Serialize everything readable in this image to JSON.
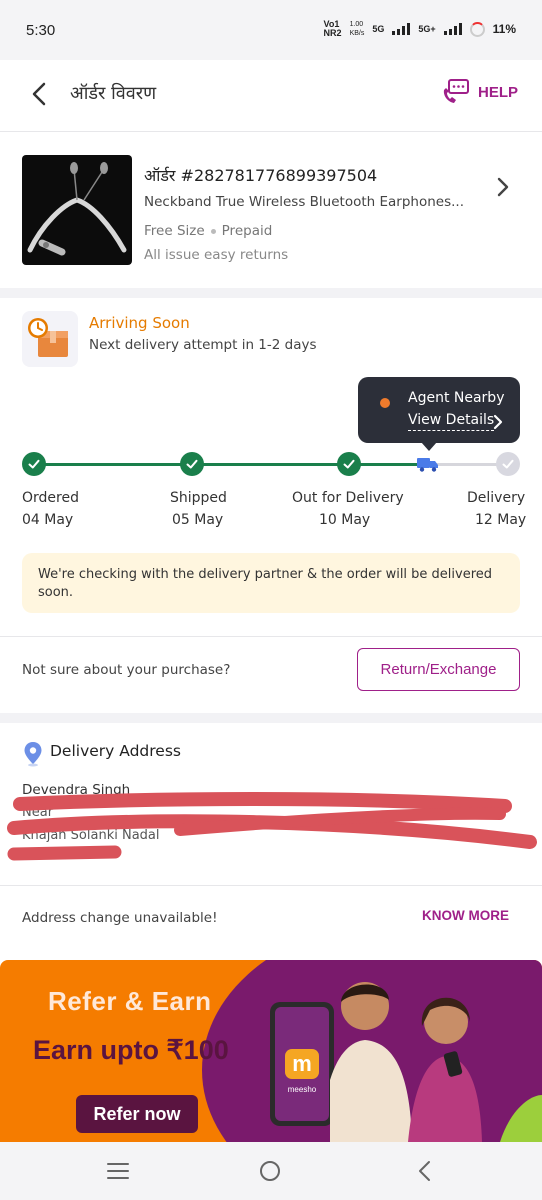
{
  "status_bar": {
    "time": "5:30",
    "carrier_top": "Vo1",
    "carrier_bottom": "NR2",
    "speed_top": "1.00",
    "speed_bottom": "KB/s",
    "net1": "5G",
    "net2": "5G+",
    "battery": "11%"
  },
  "header": {
    "title": "ऑर्डर विवरण",
    "help_label": "HELP"
  },
  "product": {
    "order_id": "ऑर्डर #282781776899397504",
    "name": "Neckband True Wireless Bluetooth Earphones...",
    "size": "Free Size",
    "payment": "Prepaid",
    "returns": "All issue easy returns"
  },
  "delivery": {
    "status": "Arriving Soon",
    "subtext": "Next delivery attempt in 1-2 days",
    "tooltip_title": "Agent Nearby",
    "tooltip_link": "View Details",
    "steps": [
      {
        "label": "Ordered",
        "date": "04 May"
      },
      {
        "label": "Shipped",
        "date": "05 May"
      },
      {
        "label": "Out for Delivery",
        "date": "10 May"
      },
      {
        "label": "Delivery",
        "date": "12 May"
      }
    ],
    "notice": "We're checking with the delivery partner & the order will be delivered soon."
  },
  "purchase": {
    "question": "Not sure about your purchase?",
    "return_button": "Return/Exchange"
  },
  "address": {
    "title": "Delivery Address",
    "name": "Devendra Singh",
    "line1": "Near",
    "line2": "Khajan Solanki Nadal",
    "change_text": "Address change unavailable!",
    "know_more": "KNOW MORE"
  },
  "banner": {
    "title": "Refer & Earn",
    "subtitle": "Earn upto ₹100",
    "button": "Refer now",
    "brand": "meesho"
  },
  "colors": {
    "accent": "#9f2089",
    "success": "#1a7f4b",
    "warning": "#e57b00",
    "tooltip_bg": "#2c2f39",
    "notice_bg": "#fff6df"
  }
}
